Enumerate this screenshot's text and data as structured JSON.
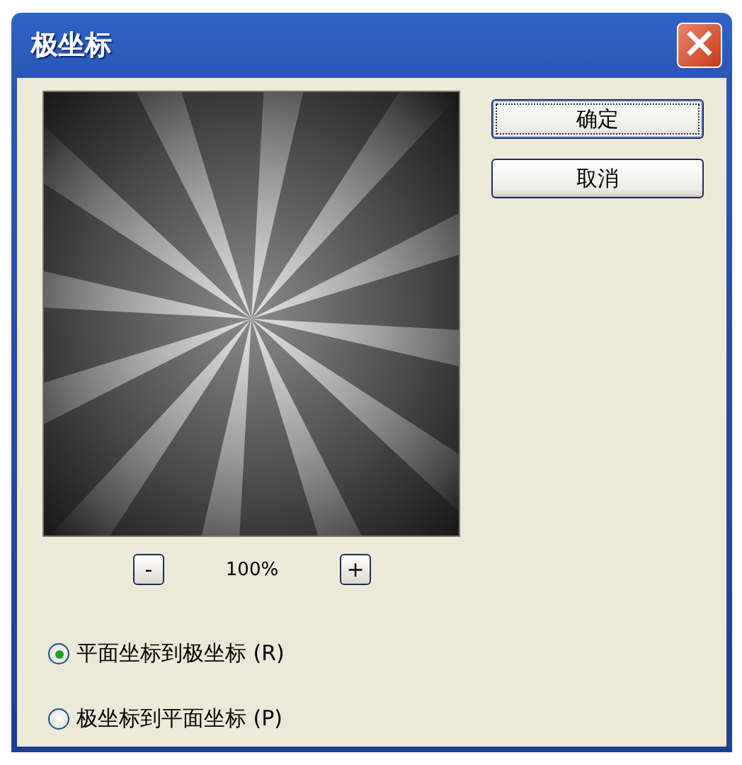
{
  "window": {
    "title": "极坐标",
    "close_icon": "×"
  },
  "zoom": {
    "minus": "-",
    "value": "100%",
    "plus": "+"
  },
  "buttons": [
    {
      "label": "确定",
      "default": true
    },
    {
      "label": "取消",
      "default": false
    }
  ],
  "options": [
    {
      "label": "平面坐标到极坐标 (R)",
      "selected": true
    },
    {
      "label": "极坐标到平面坐标 (P)",
      "selected": false
    }
  ]
}
